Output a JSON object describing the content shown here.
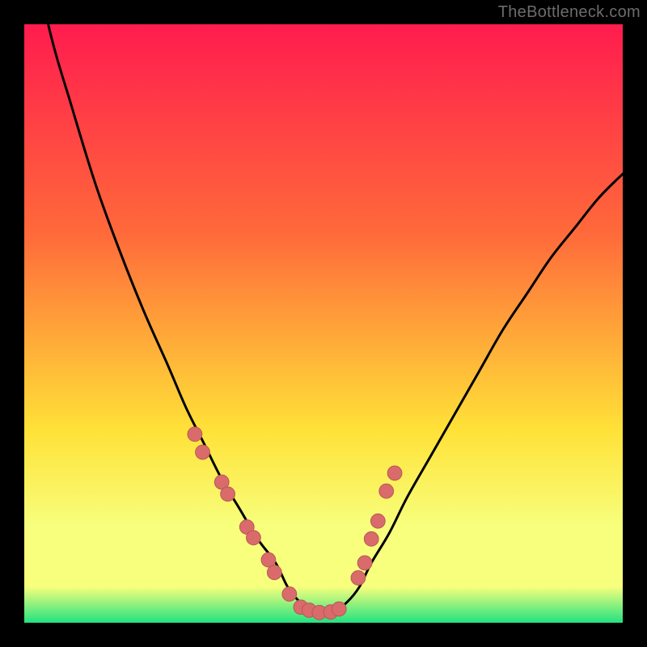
{
  "attribution": "TheBottleneck.com",
  "colors": {
    "bg": "#000000",
    "grad_top": "#ff1c4e",
    "grad_mid1": "#ff6a3a",
    "grad_mid2": "#ffe238",
    "grad_band": "#f7ff7d",
    "grad_bottom": "#22e280",
    "curve": "#000000",
    "dot_fill": "#da6b6b",
    "dot_stroke": "#b85757"
  },
  "chart_data": {
    "type": "line",
    "title": "",
    "xlabel": "",
    "ylabel": "",
    "xlim": [
      0,
      100
    ],
    "ylim": [
      0,
      100
    ],
    "series": [
      {
        "name": "bottleneck-curve",
        "x": [
          0,
          4,
          8,
          12,
          16,
          20,
          24,
          27,
          30,
          33,
          36,
          39,
          42,
          44,
          46,
          48,
          50,
          52,
          54,
          56,
          58,
          61,
          64,
          68,
          72,
          76,
          80,
          84,
          88,
          92,
          96,
          100
        ],
        "values": [
          120,
          100,
          86,
          73,
          62,
          52,
          43,
          36,
          30,
          24,
          19,
          14,
          10,
          6,
          3.5,
          2,
          1.5,
          2,
          3.5,
          6,
          10,
          15,
          21,
          28,
          35,
          42,
          49,
          55,
          61,
          66,
          71,
          75
        ]
      }
    ],
    "markers": {
      "name": "sample-points",
      "x": [
        28.5,
        29.8,
        33.0,
        34.0,
        37.2,
        38.3,
        40.8,
        41.8,
        44.3,
        46.2,
        47.6,
        49.3,
        51.2,
        52.6,
        55.8,
        56.9,
        58.0,
        59.1,
        60.5,
        61.9
      ],
      "values": [
        31.5,
        28.5,
        23.5,
        21.5,
        16.0,
        14.2,
        10.5,
        8.4,
        4.8,
        2.6,
        2.1,
        1.7,
        1.8,
        2.3,
        7.5,
        10.0,
        14.0,
        17.0,
        22.0,
        25.0
      ]
    },
    "dot_radius_pct": 1.2
  }
}
